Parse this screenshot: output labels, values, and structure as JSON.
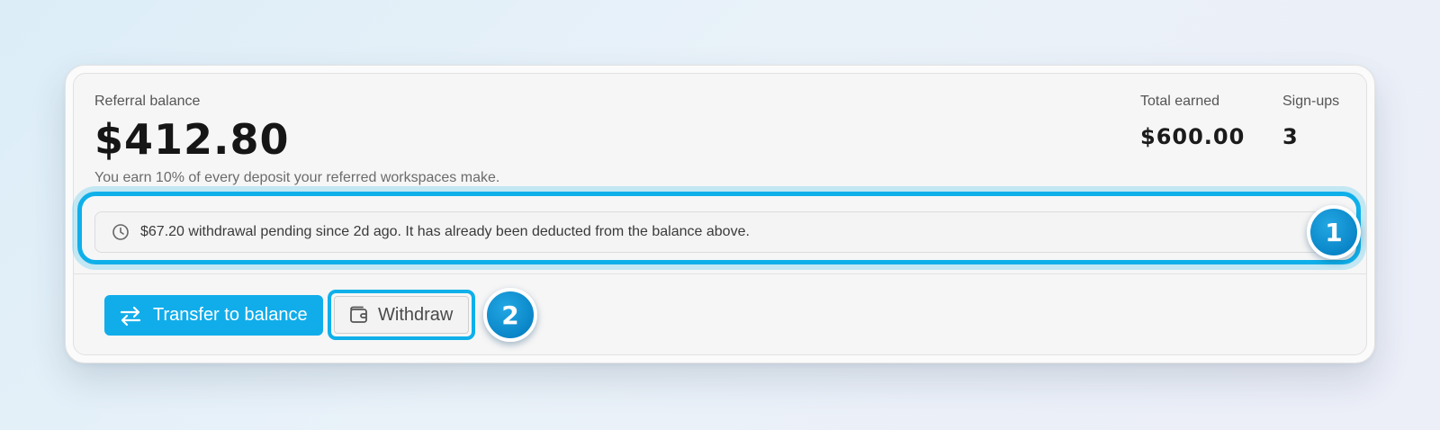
{
  "balance": {
    "label": "Referral balance",
    "amount": "$412.80",
    "description": "You earn 10% of every deposit your referred workspaces make."
  },
  "stats": {
    "total_earned_label": "Total earned",
    "total_earned_value": "$600.00",
    "signups_label": "Sign-ups",
    "signups_value": "3"
  },
  "pending_notice": {
    "icon": "clock-icon",
    "text": "$67.20 withdrawal pending since 2d ago. It has already been deducted from the balance above."
  },
  "actions": {
    "transfer_label": "Transfer to balance",
    "transfer_icon": "swap-arrows-icon",
    "withdraw_label": "Withdraw",
    "withdraw_icon": "wallet-icon"
  },
  "annotations": {
    "badge_1": "1",
    "badge_2": "2"
  },
  "colors": {
    "accent": "#11adea",
    "badge": "#0a86c8",
    "background": "#f6f6f6"
  }
}
